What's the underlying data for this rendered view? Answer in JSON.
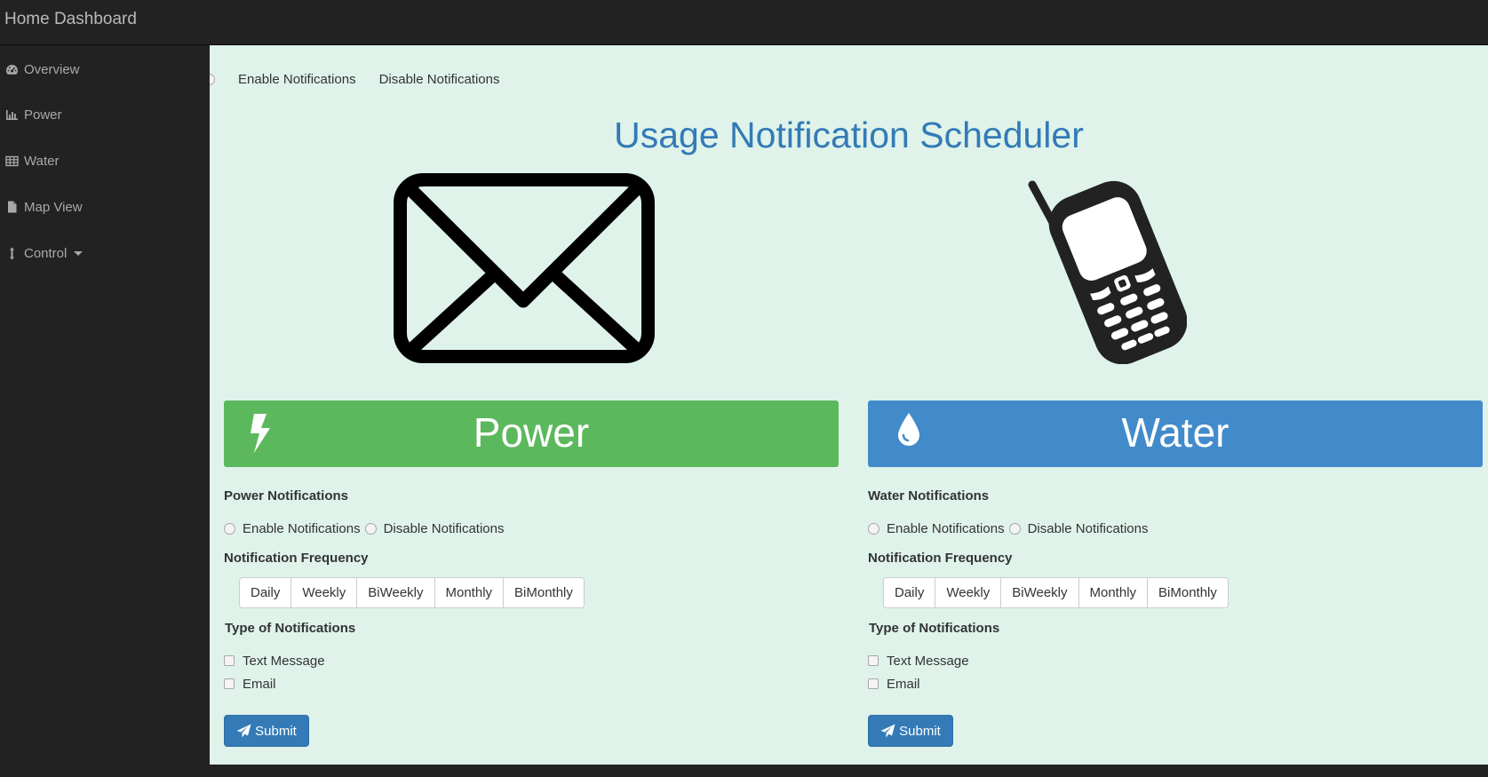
{
  "app": {
    "title": "Home Dashboard"
  },
  "sidebar": {
    "items": [
      {
        "label": "Overview",
        "icon": "dashboard-icon"
      },
      {
        "label": "Power",
        "icon": "bar-chart-icon"
      },
      {
        "label": "Water",
        "icon": "table-icon"
      },
      {
        "label": "Map View",
        "icon": "file-icon"
      },
      {
        "label": "Control",
        "icon": "resize-vertical-icon",
        "has_caret": true
      }
    ]
  },
  "top_options": {
    "enable_label": "Enable Notifications",
    "disable_label": "Disable Notifications"
  },
  "page": {
    "title": "Usage Notification Scheduler"
  },
  "colors": {
    "power_banner": "#5cb85c",
    "water_banner": "#428bca",
    "accent": "#337ab7",
    "background": "#dff3ea"
  },
  "power": {
    "banner_title": "Power",
    "notifications_label": "Power Notifications",
    "enable_label": "Enable Notifications",
    "disable_label": "Disable Notifications",
    "frequency_label": "Notification Frequency",
    "frequencies": [
      "Daily",
      "Weekly",
      "BiWeekly",
      "Monthly",
      "BiMonthly"
    ],
    "type_label": "Type of Notifications",
    "types": [
      "Text Message",
      "Email"
    ],
    "submit_label": "Submit"
  },
  "water": {
    "banner_title": "Water",
    "notifications_label": "Water Notifications",
    "enable_label": "Enable Notifications",
    "disable_label": "Disable Notifications",
    "frequency_label": "Notification Frequency",
    "frequencies": [
      "Daily",
      "Weekly",
      "BiWeekly",
      "Monthly",
      "BiMonthly"
    ],
    "type_label": "Type of Notifications",
    "types": [
      "Text Message",
      "Email"
    ],
    "submit_label": "Submit"
  }
}
